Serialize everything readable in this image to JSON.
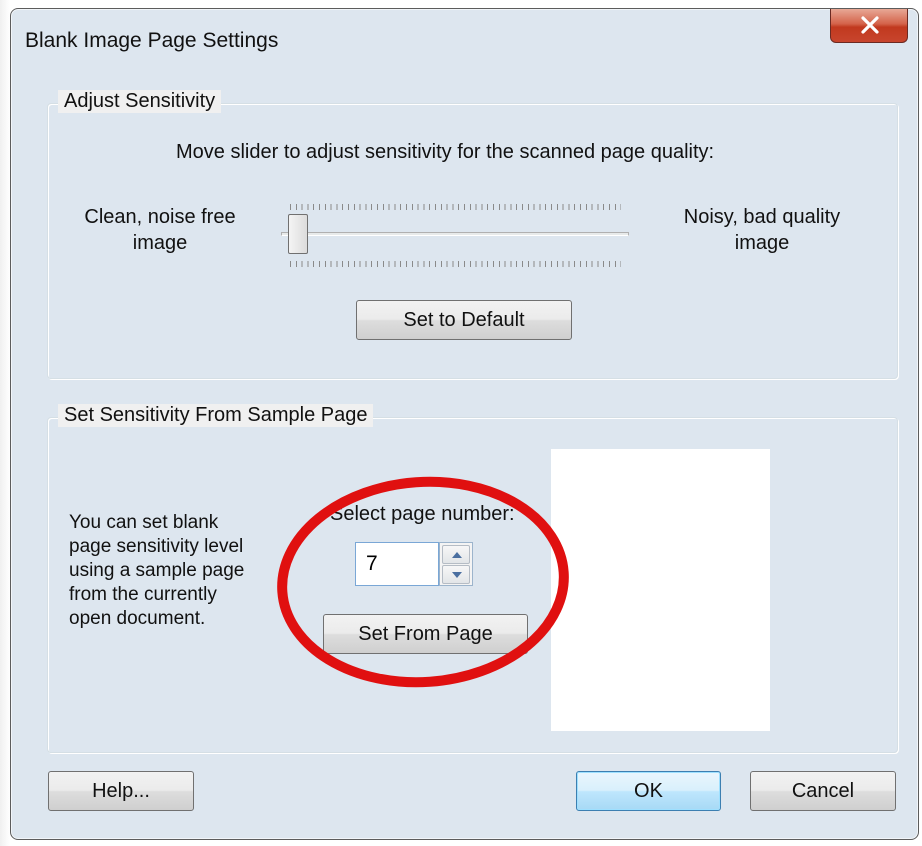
{
  "window": {
    "title": "Blank Image Page Settings",
    "close_icon": "close-x-icon",
    "close_color": "#c8452d"
  },
  "adjust_group": {
    "legend": "Adjust Sensitivity",
    "instruction": "Move slider to adjust sensitivity for the scanned page quality:",
    "left_label_line1": "Clean, noise free",
    "left_label_line2": "image",
    "right_label_line1": "Noisy, bad quality",
    "right_label_line2": "image",
    "slider_position_fraction": 0.0,
    "default_button": "Set to Default"
  },
  "sample_group": {
    "legend": "Set Sensitivity From Sample Page",
    "description_lines": [
      "You can set blank",
      "page sensitivity level",
      "using a sample page",
      "from the currently",
      "open document."
    ],
    "select_label": "Select page number:",
    "page_number_value": "7",
    "set_from_page_button": "Set From Page"
  },
  "annotation": {
    "highlight_color": "#e01010"
  },
  "footer": {
    "help_button": "Help...",
    "ok_button": "OK",
    "cancel_button": "Cancel"
  }
}
